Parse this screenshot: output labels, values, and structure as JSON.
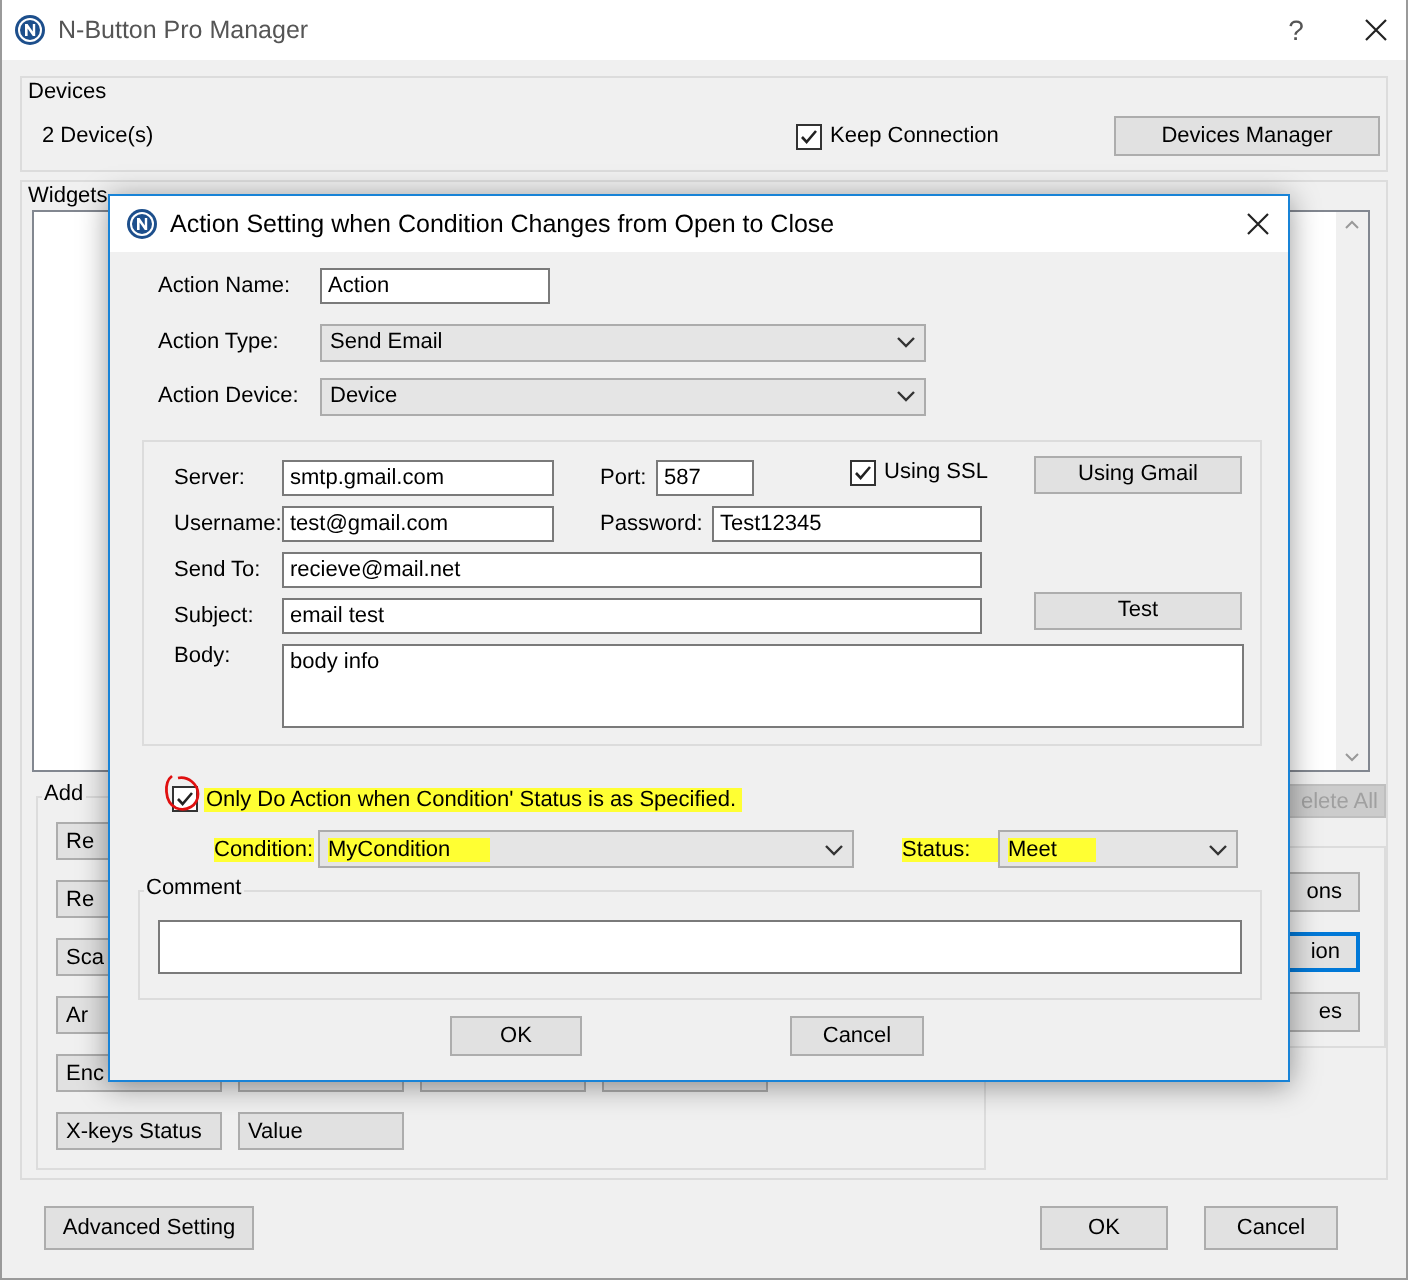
{
  "window": {
    "title": "N-Button Pro Manager",
    "help_button": "?"
  },
  "devices": {
    "title": "Devices",
    "count": "2 Device(s)",
    "keep_connection": {
      "label": "Keep Connection",
      "checked": true
    },
    "manager_button": "Devices Manager"
  },
  "widgets": {
    "title": "Widgets",
    "delete_all_button": {
      "label": "elete All",
      "disabled": true
    },
    "add": {
      "title": "Add",
      "rows": [
        [
          {
            "kind": "text",
            "label": "Re"
          }
        ],
        [
          {
            "kind": "text",
            "label": "Re"
          }
        ],
        [
          {
            "kind": "text",
            "label": "Sca"
          }
        ],
        [
          {
            "kind": "text",
            "label": "Ar"
          }
        ],
        [
          {
            "kind": "text",
            "label": "Enc"
          },
          {
            "kind": "covered"
          },
          {
            "kind": "covered"
          },
          {
            "kind": "covered"
          }
        ],
        [
          {
            "kind": "text",
            "label": "X-keys Status"
          },
          {
            "kind": "text",
            "label": "Value"
          }
        ]
      ]
    },
    "actions": [
      {
        "label": "ons",
        "focused": false
      },
      {
        "label": "ion",
        "focused": true
      },
      {
        "label": "es",
        "focused": false
      }
    ]
  },
  "footer": {
    "advanced_button": "Advanced Setting",
    "ok_button": "OK",
    "cancel_button": "Cancel"
  },
  "dialog": {
    "title": "Action Setting when Condition Changes from Open to Close",
    "action_name": {
      "label": "Action Name:",
      "value": "Action"
    },
    "action_type": {
      "label": "Action Type:",
      "value": "Send Email"
    },
    "action_device": {
      "label": "Action Device:",
      "value": "Device"
    },
    "email": {
      "server": {
        "label": "Server:",
        "value": "smtp.gmail.com"
      },
      "port": {
        "label": "Port:",
        "value": "587"
      },
      "using_ssl": {
        "label": "Using SSL",
        "checked": true
      },
      "using_gmail_button": "Using Gmail",
      "username": {
        "label": "Username:",
        "value": "test@gmail.com"
      },
      "password": {
        "label": "Password:",
        "value": "Test12345"
      },
      "send_to": {
        "label": "Send To:",
        "value": "recieve@mail.net"
      },
      "subject": {
        "label": "Subject:",
        "value": "email test"
      },
      "test_button": "Test",
      "body": {
        "label": "Body:",
        "value": "body info"
      }
    },
    "only_if": {
      "label": "Only Do Action when Condition' Status is as Specified.",
      "checked": true,
      "highlighted": true
    },
    "condition": {
      "label": "Condition:",
      "value": "MyCondition",
      "highlighted": true
    },
    "status": {
      "label": "Status:",
      "value": "Meet",
      "highlighted": true
    },
    "comment": {
      "title": "Comment"
    },
    "ok_button": "OK",
    "cancel_button": "Cancel"
  }
}
